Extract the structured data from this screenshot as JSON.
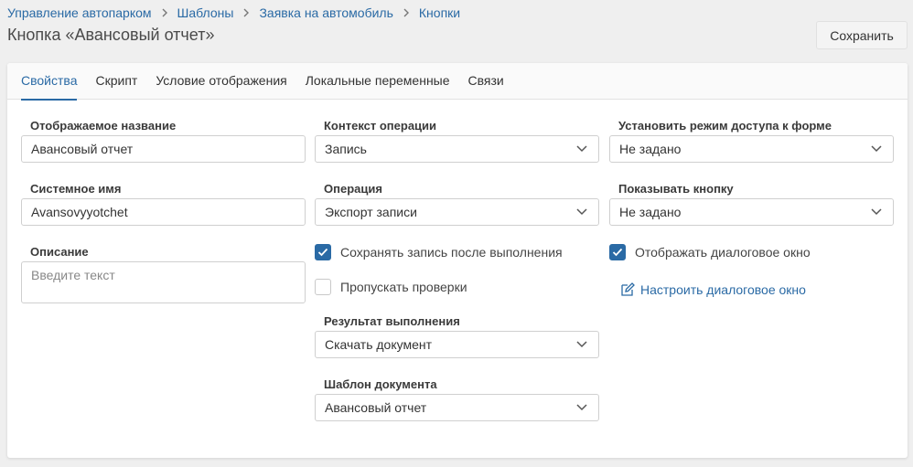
{
  "breadcrumb": [
    "Управление автопарком",
    "Шаблоны",
    "Заявка на автомобиль",
    "Кнопки"
  ],
  "page": {
    "title": "Кнопка «Авансовый отчет»",
    "save_label": "Сохранить"
  },
  "tabs": [
    "Свойства",
    "Скрипт",
    "Условие отображения",
    "Локальные переменные",
    "Связи"
  ],
  "active_tab": "Свойства",
  "form": {
    "display_name": {
      "label": "Отображаемое название",
      "value": "Авансовый отчет"
    },
    "system_name": {
      "label": "Системное имя",
      "value": "Avansovyyotchet"
    },
    "description": {
      "label": "Описание",
      "placeholder": "Введите текст"
    },
    "operation_context": {
      "label": "Контекст операции",
      "value": "Запись"
    },
    "operation": {
      "label": "Операция",
      "value": "Экспорт записи"
    },
    "save_after": {
      "label": "Сохранять запись после выполнения",
      "checked": true
    },
    "skip_checks": {
      "label": "Пропускать проверки",
      "checked": false
    },
    "result": {
      "label": "Результат выполнения",
      "value": "Скачать документ"
    },
    "doc_template": {
      "label": "Шаблон документа",
      "value": "Авансовый отчет"
    },
    "access_mode": {
      "label": "Установить режим доступа к форме",
      "value": "Не задано"
    },
    "show_button": {
      "label": "Показывать кнопку",
      "value": "Не задано"
    },
    "show_dialog": {
      "label": "Отображать диалоговое окно",
      "checked": true
    },
    "configure_dialog": {
      "label": "Настроить диалоговое окно"
    }
  },
  "colors": {
    "accent": "#2a6aa5",
    "background": "#efefef"
  }
}
